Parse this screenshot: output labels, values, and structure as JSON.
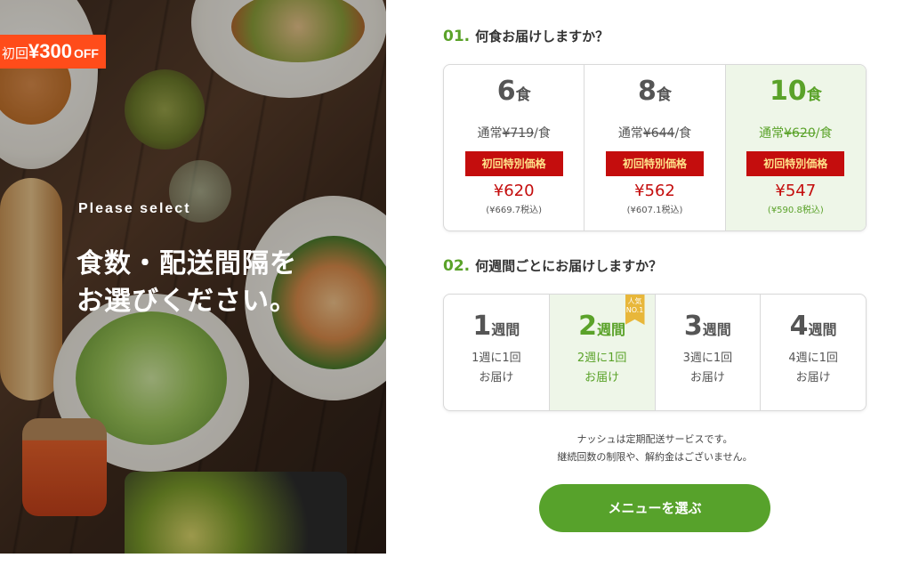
{
  "promo": {
    "prefix": "初回",
    "amount": "¥300",
    "suffix": "OFF"
  },
  "hero": {
    "kicker": "Please select",
    "headline_line1": "食数・配送間隔を",
    "headline_line2": "お選びください。"
  },
  "step1": {
    "number": "01.",
    "question": "何食お届けしますか？",
    "options": [
      {
        "count": "6",
        "unit": "食",
        "normal_prefix": "通常",
        "normal_price": "¥719",
        "normal_suffix": "/食",
        "tag": "初回特別価格",
        "price": "¥620",
        "tax_note": "(¥669.7税込)",
        "selected": false
      },
      {
        "count": "8",
        "unit": "食",
        "normal_prefix": "通常",
        "normal_price": "¥644",
        "normal_suffix": "/食",
        "tag": "初回特別価格",
        "price": "¥562",
        "tax_note": "(¥607.1税込)",
        "selected": false
      },
      {
        "count": "10",
        "unit": "食",
        "normal_prefix": "通常",
        "normal_price": "¥620",
        "normal_suffix": "/食",
        "tag": "初回特別価格",
        "price": "¥547",
        "tax_note": "(¥590.8税込)",
        "selected": true
      }
    ]
  },
  "step2": {
    "number": "02.",
    "question": "何週間ごとにお届けしますか？",
    "popular_badge": {
      "line1": "人気",
      "line2": "NO.1"
    },
    "options": [
      {
        "count": "1",
        "unit": "週間",
        "desc1": "1週に1回",
        "desc2": "お届け",
        "selected": false
      },
      {
        "count": "2",
        "unit": "週間",
        "desc1": "2週に1回",
        "desc2": "お届け",
        "selected": true
      },
      {
        "count": "3",
        "unit": "週間",
        "desc1": "3週に1回",
        "desc2": "お届け",
        "selected": false
      },
      {
        "count": "4",
        "unit": "週間",
        "desc1": "4週に1回",
        "desc2": "お届け",
        "selected": false
      }
    ]
  },
  "note": {
    "line1": "ナッシュは定期配送サービスです。",
    "line2": "継続回数の制限や、解約金はございません。"
  },
  "cta": {
    "label": "メニューを選ぶ"
  },
  "colors": {
    "accent_green": "#57a22b",
    "price_red": "#c40d0d",
    "promo_orange": "#ff4c1a",
    "selected_bg": "#eef6e8"
  }
}
